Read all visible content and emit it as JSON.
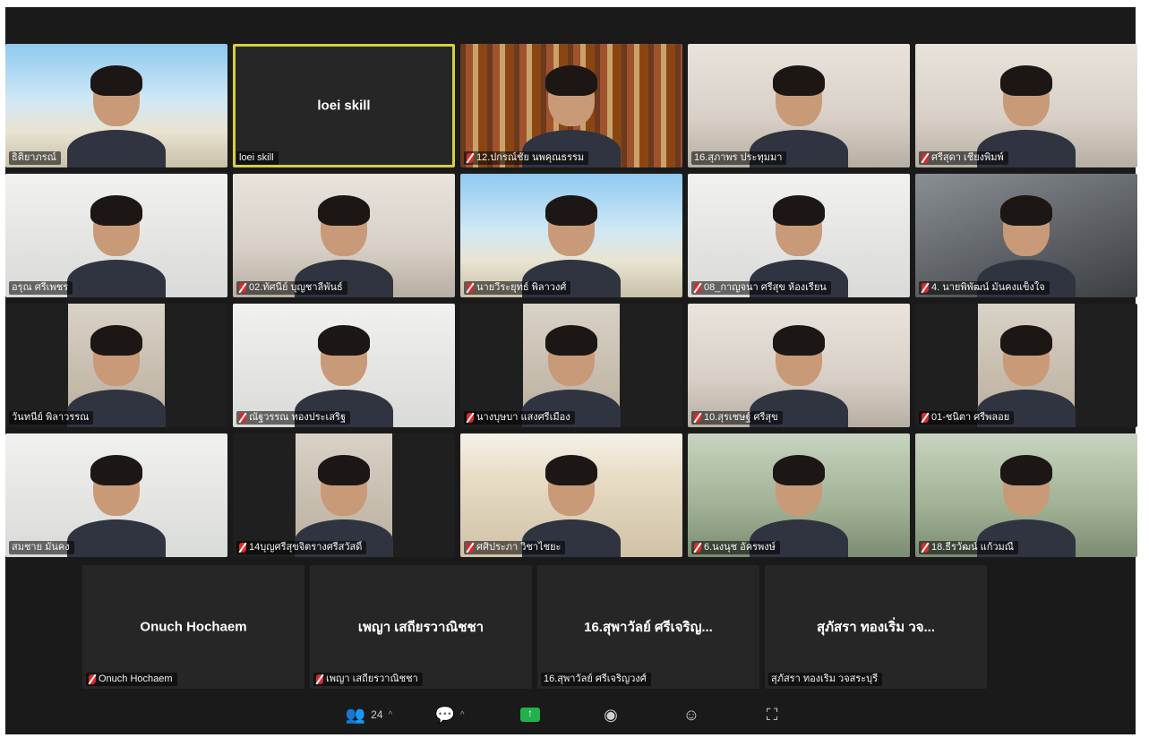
{
  "participants_grid": [
    {
      "label": "ธิติยาภรณ์",
      "bg": "beach",
      "muted": false
    },
    {
      "label": "loei skill",
      "bg": "active",
      "center_name": "loei skill",
      "muted": false
    },
    {
      "label": "12.ปกรณ์ชัย นพคุณธรรม",
      "bg": "books",
      "muted": true
    },
    {
      "label": "16.สุภาพร ประทุมมา",
      "bg": "room",
      "muted": false
    },
    {
      "label": "ศรีสุดา เชียงพิมพ์",
      "bg": "room",
      "muted": true
    },
    {
      "label": "อรุณ ศรีเพชร",
      "bg": "office",
      "muted": false
    },
    {
      "label": "02.ทัศนีย์ บุญชาลีพันธ์",
      "bg": "room",
      "muted": true
    },
    {
      "label": "นายวีระยุทธ์ พิลาวงศ์",
      "bg": "beach",
      "muted": true
    },
    {
      "label": "08_กาญจนา ศรีสุข ห้องเรียน",
      "bg": "office",
      "muted": true
    },
    {
      "label": "4. นายพิพัฒน์ มั่นคงแข็งใจ",
      "bg": "video-bg",
      "muted": true
    },
    {
      "label": "วันทนีย์ พิลาวรรณ",
      "bg": "pillar",
      "muted": false,
      "inset": true
    },
    {
      "label": "ณัฐวรรณ ทองประเสริฐ",
      "bg": "office",
      "muted": true
    },
    {
      "label": "นางบุษบา แสงศรีเมือง",
      "bg": "pillar",
      "muted": true,
      "inset": true
    },
    {
      "label": "10.สุรเชษฐ์ ศรีสุข",
      "bg": "room",
      "muted": true
    },
    {
      "label": "01-ชนิตา ศรีพลอย",
      "bg": "pillar",
      "muted": true,
      "inset": true
    },
    {
      "label": "สมชาย มั่นคง",
      "bg": "office",
      "muted": false
    },
    {
      "label": "14บุญศรีสุขจิตรางศรีสวัสดิ์",
      "bg": "pillar",
      "muted": true,
      "inset": true
    },
    {
      "label": "ศศิประภา วิชาไชยะ",
      "bg": "banner",
      "muted": true
    },
    {
      "label": "6.นงนุช อัครพงษ์",
      "bg": "outdoor",
      "muted": true
    },
    {
      "label": "18.ธีรวัฒน์ แก้วมณี",
      "bg": "outdoor",
      "muted": true
    }
  ],
  "bottom_row": [
    {
      "center_name": "Onuch Hochaem",
      "label": "Onuch Hochaem",
      "muted": true
    },
    {
      "center_name": "เพญา เสถียรวาณิชชา",
      "label": "เพญา เสถียรวาณิชชา",
      "muted": true
    },
    {
      "center_name": "16.สุพาวัลย์ ศรีเจริญ...",
      "label": "16.สุพาวัลย์ ศรีเจริญวงศ์",
      "muted": false
    },
    {
      "center_name": "สุภัสรา ทองเริ่ม วจ...",
      "label": "สุภัสรา ทองเริ่ม วจสระบุรี",
      "muted": false
    }
  ],
  "toolbar": {
    "participants_count": "24",
    "caret": "^",
    "participants_icon": "participants-icon",
    "chat_icon": "chat-icon",
    "share_icon": "share-screen-icon",
    "record_icon": "record-icon",
    "reactions_icon": "reactions-icon",
    "more_icon": "fullscreen-icon"
  },
  "colors": {
    "active_speaker_border": "#d6d03a",
    "muted_mic": "#e02828",
    "share_button": "#21b14b",
    "window_bg": "#1a1a1a"
  }
}
